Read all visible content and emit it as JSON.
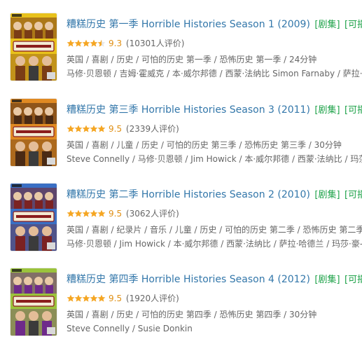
{
  "results": [
    {
      "title": "糟糕历史 第一季 Horrible Histories Season 1 (2009)",
      "tag_series": "[剧集]",
      "tag_playable": "[可播放]",
      "stars": 4.5,
      "score": "9.3",
      "rating_count": "(10301人评价)",
      "meta": "英国 / 喜剧 / 历史 / 可怕的历史 第一季 / 恐怖历史 第一季 / 24分钟",
      "cast": "马修·贝恩顿 / 吉姆·霍威克 / 本·威尔邦德 / 西蒙·法纳比 Simon Farnaby / 萨拉·哈德兰",
      "cover_bg": "#e8c21c",
      "cover_accent": "#7a3d16"
    },
    {
      "title": "糟糕历史 第三季 Horrible Histories Season 3 (2011)",
      "tag_series": "[剧集]",
      "tag_playable": "[可播放]",
      "stars": 5,
      "score": "9.5",
      "rating_count": "(2339人评价)",
      "meta": "英国 / 喜剧 / 儿童 / 历史 / 可怕的历史 第三季 / 恐怖历史 第三季 / 30分钟",
      "cast": "Steve Connelly / 马修·贝恩顿 / Jim Howick / 本·威尔邦德 / 西蒙·法纳比 / 玛莎·豪",
      "cover_bg": "#e08a22",
      "cover_accent": "#4a2a14"
    },
    {
      "title": "糟糕历史 第二季 Horrible Histories Season 2 (2010)",
      "tag_series": "[剧集]",
      "tag_playable": "[可播放]",
      "stars": 5,
      "score": "9.5",
      "rating_count": "(3062人评价)",
      "meta": "英国 / 喜剧 / 纪录片 / 音乐 / 儿童 / 历史 / 可怕的历史 第二季 / 恐怖历史 第二季 /",
      "cast": "马修·贝恩顿 / Jim Howick / 本·威尔邦德 / 西蒙·法纳比 / 萨拉·哈德兰 / 玛莎·豪-道",
      "cover_bg": "#3a6fc4",
      "cover_accent": "#7b2222"
    },
    {
      "title": "糟糕历史 第四季 Horrible Histories Season 4 (2012)",
      "tag_series": "[剧集]",
      "tag_playable": "[可播放]",
      "stars": 5,
      "score": "9.5",
      "rating_count": "(1920人评价)",
      "meta": "英国 / 喜剧 / 历史 / 可怕的历史 第四季 / 恐怖历史 第四季 / 30分钟",
      "cast": "Steve Connelly / Susie Donkin",
      "cover_bg": "#9bc33c",
      "cover_accent": "#6e2a8a"
    }
  ],
  "colors": {
    "link": "#3377aa",
    "tag": "#1fa34a",
    "star": "#f5a623",
    "score": "#e09015",
    "meta": "#666666"
  },
  "icons": {
    "star_full": "star-icon",
    "star_half": "half-star-icon"
  }
}
